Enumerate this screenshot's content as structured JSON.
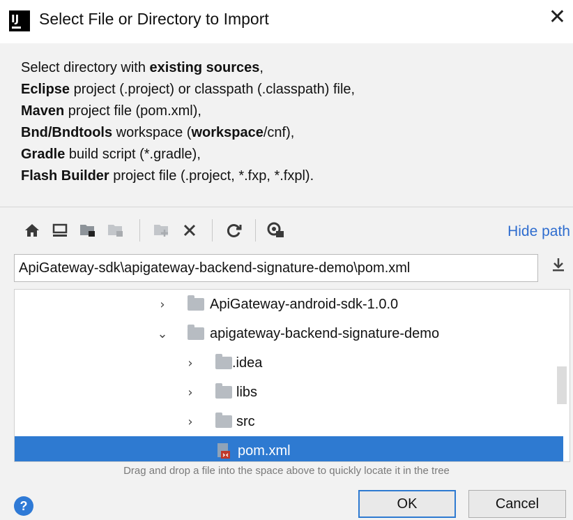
{
  "window": {
    "title": "Select File or Directory to Import",
    "app_icon": "IJ",
    "close_glyph": "✕"
  },
  "description": [
    {
      "parts": [
        {
          "t": "Select directory with ",
          "b": false
        },
        {
          "t": "existing sources",
          "b": true
        },
        {
          "t": ",",
          "b": false
        }
      ]
    },
    {
      "parts": [
        {
          "t": "Eclipse",
          "b": true
        },
        {
          "t": " project (.project) or classpath (.classpath) file,",
          "b": false
        }
      ]
    },
    {
      "parts": [
        {
          "t": "Maven",
          "b": true
        },
        {
          "t": " project file (pom.xml),",
          "b": false
        }
      ]
    },
    {
      "parts": [
        {
          "t": "Bnd/Bndtools",
          "b": true
        },
        {
          "t": " workspace (",
          "b": false
        },
        {
          "t": "workspace",
          "b": true
        },
        {
          "t": "/cnf),",
          "b": false
        }
      ]
    },
    {
      "parts": [
        {
          "t": "Gradle",
          "b": true
        },
        {
          "t": " build script (*.gradle),",
          "b": false
        }
      ]
    },
    {
      "parts": [
        {
          "t": "Flash Builder",
          "b": true
        },
        {
          "t": " project file (.project, *.fxp, *.fxpl).",
          "b": false
        }
      ]
    }
  ],
  "toolbar": {
    "buttons": [
      {
        "name": "home-icon",
        "glyph": "🏠",
        "enabled": true
      },
      {
        "name": "desktop-icon",
        "glyph": "▭",
        "enabled": true
      },
      {
        "name": "project-folder-icon",
        "glyph": "▆",
        "enabled": true
      },
      {
        "name": "module-folder-icon",
        "glyph": "▆",
        "enabled": false
      },
      {
        "name": "new-folder-icon",
        "glyph": "▆",
        "enabled": false
      },
      {
        "name": "delete-icon",
        "glyph": "✕",
        "enabled": true
      },
      {
        "name": "refresh-icon",
        "glyph": "↻",
        "enabled": true
      },
      {
        "name": "show-hidden-icon",
        "glyph": "◉",
        "enabled": true
      }
    ],
    "hide_path_label": "Hide path"
  },
  "path": {
    "value": "ApiGateway-sdk\\apigateway-backend-signature-demo\\pom.xml"
  },
  "tree": {
    "rows": [
      {
        "label": "ApiGateway-android-sdk-1.0.0",
        "type": "folder",
        "expanded": false,
        "depth": 0
      },
      {
        "label": "apigateway-backend-signature-demo",
        "type": "folder",
        "expanded": true,
        "depth": 0
      },
      {
        "label": ".idea",
        "type": "folder",
        "expanded": false,
        "depth": 1
      },
      {
        "label": "libs",
        "type": "folder",
        "expanded": false,
        "depth": 1
      },
      {
        "label": "src",
        "type": "folder",
        "expanded": false,
        "depth": 1
      },
      {
        "label": "pom.xml",
        "type": "file",
        "expanded": false,
        "depth": 1,
        "selected": true
      }
    ]
  },
  "hint": "Drag and drop a file into the space above to quickly locate it in the tree",
  "buttons": {
    "help_glyph": "?",
    "ok": "OK",
    "cancel": "Cancel"
  },
  "colors": {
    "selection": "#2e7ad1",
    "link": "#2f6dcf",
    "folder": "#b7bcc2"
  }
}
